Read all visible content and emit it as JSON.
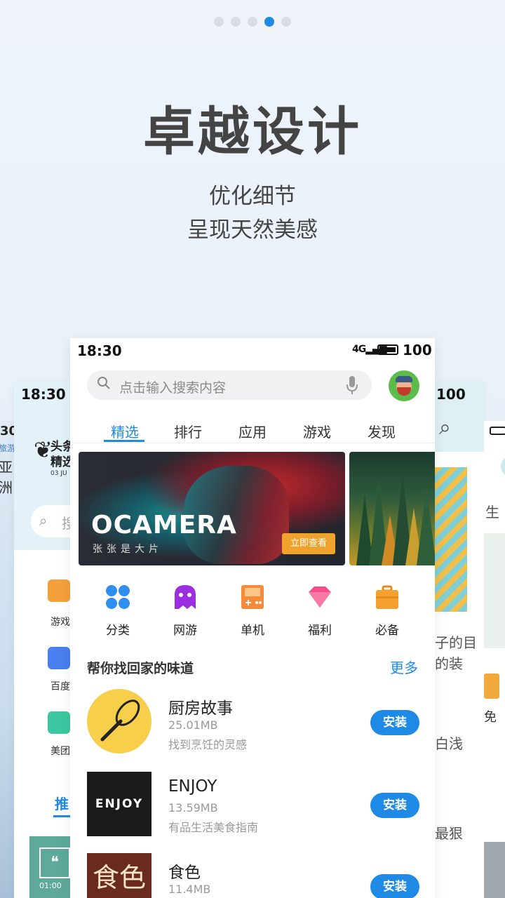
{
  "pager": {
    "count": 5,
    "active_index": 3
  },
  "hero": {
    "title": "卓越设计",
    "line1": "优化细节",
    "line2": "呈现天然美感"
  },
  "bg_far_left": {
    "time": "30",
    "tag": "旅游社区",
    "text": "亚洲"
  },
  "bg_left": {
    "time": "18:30",
    "headline1": "头条",
    "headline2": "精选",
    "date": "03 JU",
    "search_placeholder": "搜",
    "items": [
      {
        "label": "游戏",
        "color": "#f4a03a"
      },
      {
        "label": "百度",
        "color": "#4a7ff0"
      },
      {
        "label": "美团",
        "color": "#3cc7a0"
      }
    ],
    "tab": "推",
    "thumb_time": "01:00"
  },
  "bg_right": {
    "battery": "100",
    "texts": [
      "子的目",
      "的装",
      "白浅",
      "最狠"
    ]
  },
  "bg_far_right": {
    "text1": "生",
    "text2": "免"
  },
  "main": {
    "status": {
      "time": "18:30",
      "signal": "4G",
      "battery": "100"
    },
    "search": {
      "placeholder": "点击输入搜索内容"
    },
    "tabs": [
      {
        "label": "精选",
        "active": true
      },
      {
        "label": "排行",
        "active": false
      },
      {
        "label": "应用",
        "active": false
      },
      {
        "label": "游戏",
        "active": false
      },
      {
        "label": "发现",
        "active": false
      }
    ],
    "banner": {
      "title": "OCAMERA",
      "subtitle": "张张是大片",
      "cta": "立即查看"
    },
    "categories": [
      {
        "label": "分类",
        "icon": "grid-icon",
        "color": "#2f8ef0"
      },
      {
        "label": "网游",
        "icon": "ghost-icon",
        "color": "#9a2ee0"
      },
      {
        "label": "单机",
        "icon": "gamepad-icon",
        "color": "#f48a3a"
      },
      {
        "label": "福利",
        "icon": "diamond-icon",
        "color": "#f0508a"
      },
      {
        "label": "必备",
        "icon": "briefcase-icon",
        "color": "#f4a030"
      }
    ],
    "section": {
      "title": "帮你找回家的味道",
      "more": "更多"
    },
    "apps": [
      {
        "name": "厨房故事",
        "size": "25.01MB",
        "desc": "找到烹饪的灵感",
        "install": "安装"
      },
      {
        "name": "ENJOY",
        "size": "13.59MB",
        "desc": "有品生活美食指南",
        "install": "安装"
      },
      {
        "name": "食色",
        "size": "11.4MB",
        "desc": "",
        "install": "安装"
      }
    ],
    "app_logos": {
      "enjoy_text": "ENJOY",
      "shise_text": "食色"
    }
  }
}
